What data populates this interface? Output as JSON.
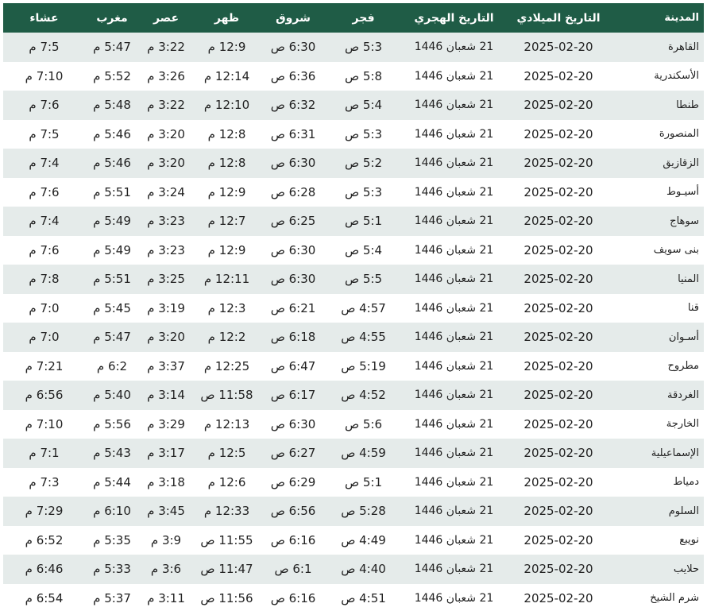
{
  "headers": {
    "city": "المدينة",
    "gregorian": "التاريخ الميلادي",
    "hijri": "التاريخ الهجري",
    "fajr": "فجر",
    "sunrise": "شروق",
    "dhuhr": "ظهر",
    "asr": "عصر",
    "maghrib": "مغرب",
    "isha": "عشاء"
  },
  "rows": [
    {
      "city": "القاهرة",
      "gregorian": "2025-02-20",
      "hijri": "21 شعبان 1446",
      "fajr": "5:3 ص",
      "sunrise": "6:30 ص",
      "dhuhr": "12:9 م",
      "asr": "3:22 م",
      "maghrib": "5:47 م",
      "isha": "7:5 م"
    },
    {
      "city": "الأسكندرية",
      "gregorian": "2025-02-20",
      "hijri": "21 شعبان 1446",
      "fajr": "5:8 ص",
      "sunrise": "6:36 ص",
      "dhuhr": "12:14 م",
      "asr": "3:26 م",
      "maghrib": "5:52 م",
      "isha": "7:10 م"
    },
    {
      "city": "طنطا",
      "gregorian": "2025-02-20",
      "hijri": "21 شعبان 1446",
      "fajr": "5:4 ص",
      "sunrise": "6:32 ص",
      "dhuhr": "12:10 م",
      "asr": "3:22 م",
      "maghrib": "5:48 م",
      "isha": "7:6 م"
    },
    {
      "city": "المنصورة",
      "gregorian": "2025-02-20",
      "hijri": "21 شعبان 1446",
      "fajr": "5:3 ص",
      "sunrise": "6:31 ص",
      "dhuhr": "12:8 م",
      "asr": "3:20 م",
      "maghrib": "5:46 م",
      "isha": "7:5 م"
    },
    {
      "city": "الزقازيق",
      "gregorian": "2025-02-20",
      "hijri": "21 شعبان 1446",
      "fajr": "5:2 ص",
      "sunrise": "6:30 ص",
      "dhuhr": "12:8 م",
      "asr": "3:20 م",
      "maghrib": "5:46 م",
      "isha": "7:4 م"
    },
    {
      "city": "أسيـوط",
      "gregorian": "2025-02-20",
      "hijri": "21 شعبان 1446",
      "fajr": "5:3 ص",
      "sunrise": "6:28 ص",
      "dhuhr": "12:9 م",
      "asr": "3:24 م",
      "maghrib": "5:51 م",
      "isha": "7:6 م"
    },
    {
      "city": "سوهاج",
      "gregorian": "2025-02-20",
      "hijri": "21 شعبان 1446",
      "fajr": "5:1 ص",
      "sunrise": "6:25 ص",
      "dhuhr": "12:7 م",
      "asr": "3:23 م",
      "maghrib": "5:49 م",
      "isha": "7:4 م"
    },
    {
      "city": "بنى سويف",
      "gregorian": "2025-02-20",
      "hijri": "21 شعبان 1446",
      "fajr": "5:4 ص",
      "sunrise": "6:30 ص",
      "dhuhr": "12:9 م",
      "asr": "3:23 م",
      "maghrib": "5:49 م",
      "isha": "7:6 م"
    },
    {
      "city": "المنيا",
      "gregorian": "2025-02-20",
      "hijri": "21 شعبان 1446",
      "fajr": "5:5 ص",
      "sunrise": "6:30 ص",
      "dhuhr": "12:11 م",
      "asr": "3:25 م",
      "maghrib": "5:51 م",
      "isha": "7:8 م"
    },
    {
      "city": "قنا",
      "gregorian": "2025-02-20",
      "hijri": "21 شعبان 1446",
      "fajr": "4:57 ص",
      "sunrise": "6:21 ص",
      "dhuhr": "12:3 م",
      "asr": "3:19 م",
      "maghrib": "5:45 م",
      "isha": "7:0 م"
    },
    {
      "city": "أسـوان",
      "gregorian": "2025-02-20",
      "hijri": "21 شعبان 1446",
      "fajr": "4:55 ص",
      "sunrise": "6:18 ص",
      "dhuhr": "12:2 م",
      "asr": "3:20 م",
      "maghrib": "5:47 م",
      "isha": "7:0 م"
    },
    {
      "city": "مطروح",
      "gregorian": "2025-02-20",
      "hijri": "21 شعبان 1446",
      "fajr": "5:19 ص",
      "sunrise": "6:47 ص",
      "dhuhr": "12:25 م",
      "asr": "3:37 م",
      "maghrib": "6:2 م",
      "isha": "7:21 م"
    },
    {
      "city": "الغردقة",
      "gregorian": "2025-02-20",
      "hijri": "21 شعبان 1446",
      "fajr": "4:52 ص",
      "sunrise": "6:17 ص",
      "dhuhr": "11:58 ص",
      "asr": "3:14 م",
      "maghrib": "5:40 م",
      "isha": "6:56 م"
    },
    {
      "city": "الخارجة",
      "gregorian": "2025-02-20",
      "hijri": "21 شعبان 1446",
      "fajr": "5:6 ص",
      "sunrise": "6:30 ص",
      "dhuhr": "12:13 م",
      "asr": "3:29 م",
      "maghrib": "5:56 م",
      "isha": "7:10 م"
    },
    {
      "city": "الإسماعيلية",
      "gregorian": "2025-02-20",
      "hijri": "21 شعبان 1446",
      "fajr": "4:59 ص",
      "sunrise": "6:27 ص",
      "dhuhr": "12:5 م",
      "asr": "3:17 م",
      "maghrib": "5:43 م",
      "isha": "7:1 م"
    },
    {
      "city": "دمياط",
      "gregorian": "2025-02-20",
      "hijri": "21 شعبان 1446",
      "fajr": "5:1 ص",
      "sunrise": "6:29 ص",
      "dhuhr": "12:6 م",
      "asr": "3:18 م",
      "maghrib": "5:44 م",
      "isha": "7:3 م"
    },
    {
      "city": "السلوم",
      "gregorian": "2025-02-20",
      "hijri": "21 شعبان 1446",
      "fajr": "5:28 ص",
      "sunrise": "6:56 ص",
      "dhuhr": "12:33 م",
      "asr": "3:45 م",
      "maghrib": "6:10 م",
      "isha": "7:29 م"
    },
    {
      "city": "نويبع",
      "gregorian": "2025-02-20",
      "hijri": "21 شعبان 1446",
      "fajr": "4:49 ص",
      "sunrise": "6:16 ص",
      "dhuhr": "11:55 ص",
      "asr": "3:9 م",
      "maghrib": "5:35 م",
      "isha": "6:52 م"
    },
    {
      "city": "حلايب",
      "gregorian": "2025-02-20",
      "hijri": "21 شعبان 1446",
      "fajr": "4:40 ص",
      "sunrise": "6:1 ص",
      "dhuhr": "11:47 ص",
      "asr": "3:6 م",
      "maghrib": "5:33 م",
      "isha": "6:46 م"
    },
    {
      "city": "شرم الشيخ",
      "gregorian": "2025-02-20",
      "hijri": "21 شعبان 1446",
      "fajr": "4:51 ص",
      "sunrise": "6:16 ص",
      "dhuhr": "11:56 ص",
      "asr": "3:11 م",
      "maghrib": "5:37 م",
      "isha": "6:54 م"
    }
  ]
}
